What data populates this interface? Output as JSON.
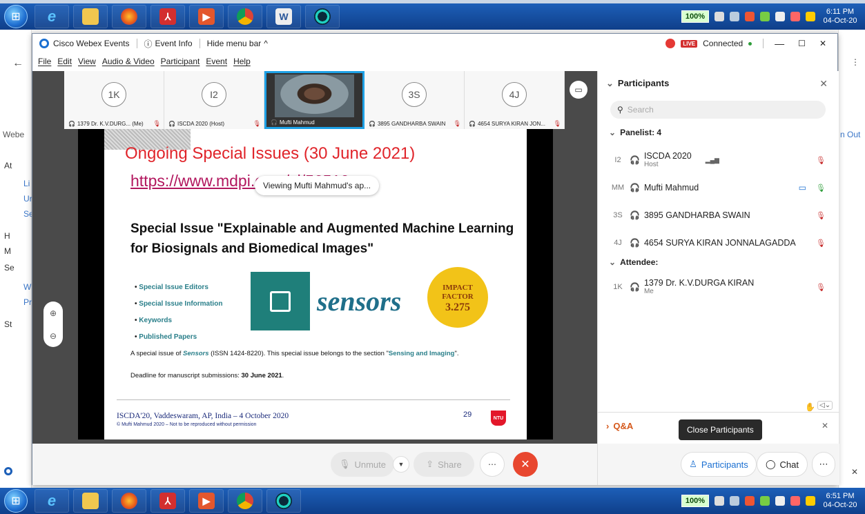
{
  "taskbar": {
    "battery": "100%",
    "time": "6:11 PM",
    "date": "04-Oct-20",
    "time_bottom": "6:51 PM",
    "date_bottom": "04-Oct-20"
  },
  "background_page": {
    "side_items": [
      "Webe",
      "At",
      "Li",
      "Ur",
      "Se",
      "H",
      "M",
      "Se",
      "W",
      "Pr",
      "St"
    ],
    "sign_out": "n Out"
  },
  "window": {
    "app_title": "Cisco Webex Events",
    "event_info": "Event Info",
    "hide_menu": "Hide menu bar",
    "live_badge": "LIVE",
    "connection": "Connected",
    "menu": [
      "File",
      "Edit",
      "View",
      "Audio & Video",
      "Participant",
      "Event",
      "Help"
    ]
  },
  "thumbnails": [
    {
      "initials": "1K",
      "caption": "1379 Dr. K.V.DURG... (Me)"
    },
    {
      "initials": "I2",
      "caption": "ISCDA 2020 (Host)"
    },
    {
      "initials": "",
      "caption": "Mufti Mahmud"
    },
    {
      "initials": "3S",
      "caption": "3895 GANDHARBA SWAIN"
    },
    {
      "initials": "4J",
      "caption": "4654 SURYA KIRAN JON..."
    }
  ],
  "viewing_label": "Viewing Mufti Mahmud's ap...",
  "slide": {
    "title": "Ongoing Special Issues (30 June 2021)",
    "link": "https://www.mdpi.com/si/56510",
    "heading": "Special Issue \"Explainable and Augmented Machine Learning for Biosignals and Biomedical Images\"",
    "links": [
      "Special Issue Editors",
      "Special Issue Information",
      "Keywords",
      "Published Papers"
    ],
    "journal": "sensors",
    "impact_label_1": "IMPACT",
    "impact_label_2": "FACTOR",
    "impact_value": "3.275",
    "desc_pre": "A special issue of ",
    "desc_journal": "Sensors",
    "desc_mid": " (ISSN 1424-8220). This special issue belongs to the section \"",
    "desc_section": "Sensing and Imaging",
    "desc_post": "\".",
    "deadline_pre": "Deadline for manuscript submissions: ",
    "deadline_date": "30 June 2021",
    "deadline_post": ".",
    "footer": "ISCDA'20, Vaddeswaram, AP, India – 4 October 2020",
    "copyright": "© Mufti Mahmud 2020 – Not to be reproduced without permission",
    "page_number": "29",
    "logo": "NTU"
  },
  "controls": {
    "unmute": "Unmute",
    "share": "Share"
  },
  "panel": {
    "title": "Participants",
    "search_placeholder": "Search",
    "panelist_header": "Panelist: 4",
    "panelists": [
      {
        "initials": "I2",
        "name": "ISCDA 2020",
        "role": "Host"
      },
      {
        "initials": "MM",
        "name": "Mufti Mahmud",
        "role": ""
      },
      {
        "initials": "3S",
        "name": "3895 GANDHARBA SWAIN",
        "role": ""
      },
      {
        "initials": "4J",
        "name": "4654 SURYA KIRAN JONNALAGADDA",
        "role": ""
      }
    ],
    "attendee_header": "Attendee:",
    "attendees": [
      {
        "initials": "1K",
        "name": "1379 Dr. K.V.DURGA KIRAN",
        "role": "Me"
      }
    ],
    "qa": "Q&A",
    "tooltip": "Close Participants",
    "participants_button": "Participants",
    "chat_button": "Chat"
  }
}
